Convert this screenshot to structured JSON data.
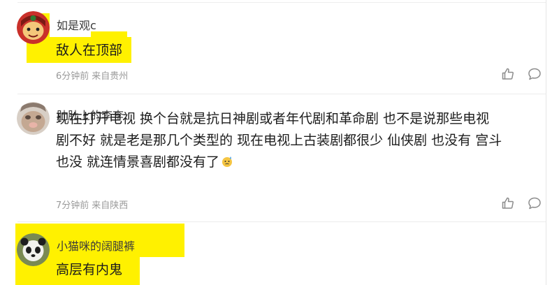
{
  "comments": [
    {
      "username": "如是观c",
      "content": "敌人在顶部",
      "time": "6分钟前",
      "location": "来自贵州",
      "avatar_icon": "cartoon-face-avatar"
    },
    {
      "username": "肚肚上的李李",
      "content_lines": [
        "现在打开电视 换个台就是抗日神剧或者年代剧和革命剧 也不是说那些电视",
        "剧不好 就是老是那几个类型的 现在电视上古装剧都很少 仙侠剧 也没有 宫斗",
        "也没 就连情景喜剧都没有了"
      ],
      "emoji_icon": "sweating-face-emoji",
      "time": "7分钟前",
      "location": "来自陕西",
      "avatar_icon": "photo-avatar"
    },
    {
      "username": "小猫咪的阔腿裤",
      "content": "高层有内鬼",
      "avatar_icon": "panda-avatar"
    }
  ],
  "colors": {
    "highlight": "#fff100",
    "meta_text": "#9a9a9a",
    "body_text": "#1c1c1c"
  }
}
